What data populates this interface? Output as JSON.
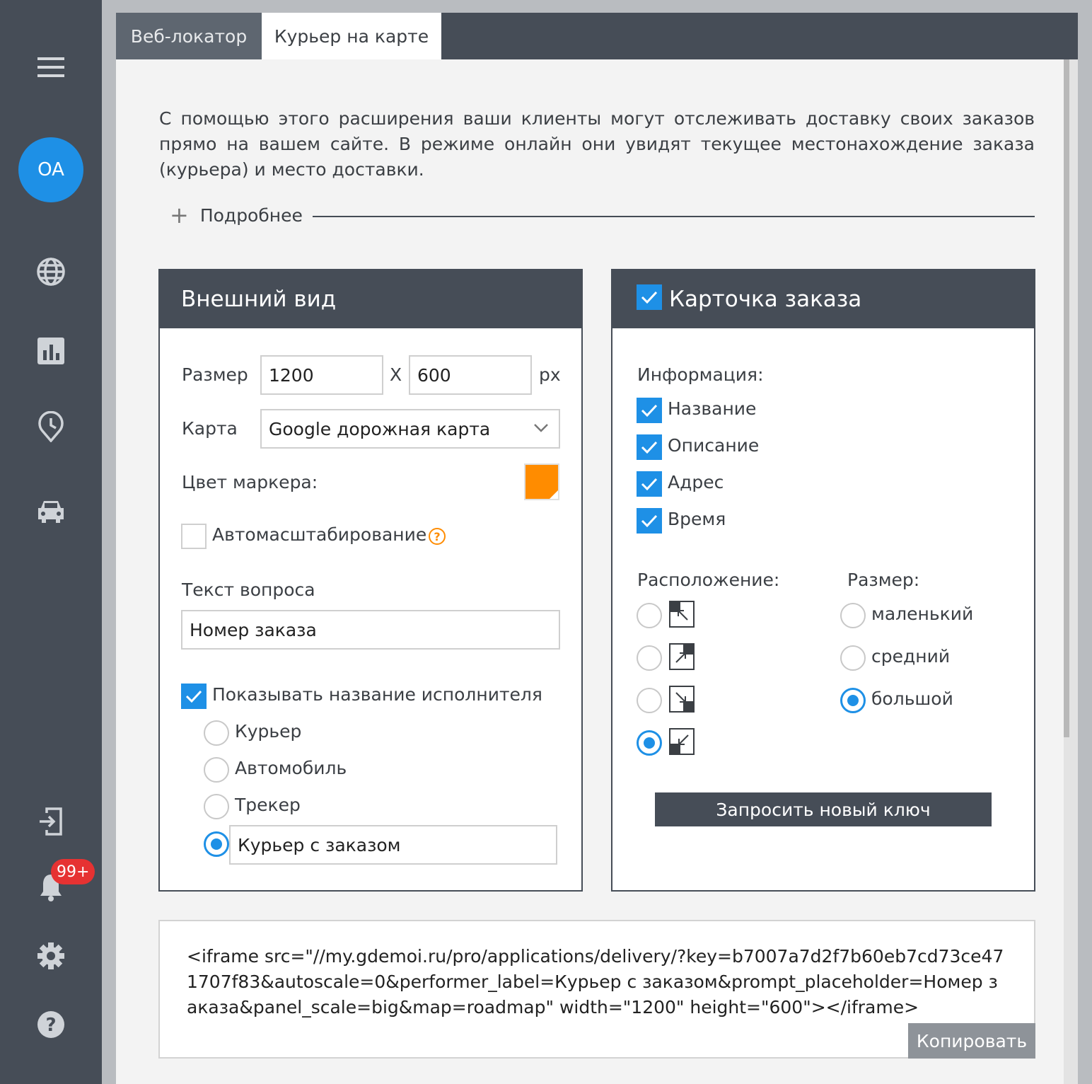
{
  "sidebar": {
    "avatar": "OA",
    "notifications_badge": "99+",
    "icons": [
      "menu-icon",
      "globe-icon",
      "chart-icon",
      "history-icon",
      "car-icon",
      "logout-icon",
      "bell-icon",
      "gear-icon",
      "help-icon"
    ]
  },
  "tabs": [
    {
      "label": "Веб-локатор",
      "active": false
    },
    {
      "label": "Курьер на карте",
      "active": true
    }
  ],
  "description": "С помощью этого расширения ваши клиенты могут отслеживать доставку своих заказов прямо на вашем сайте. В режиме онлайн они увидят текущее местонахождение заказа (курьера) и место доставки.",
  "more_label": "Подробнее",
  "appearance": {
    "title": "Внешний вид",
    "size_label": "Размер",
    "width": "1200",
    "x_label": "X",
    "height": "600",
    "unit": "px",
    "map_label": "Карта",
    "map_value": "Google дорожная карта",
    "marker_color_label": "Цвет маркера:",
    "marker_color": "#ff8c00",
    "autoscale_label": "Автомасштабирование",
    "autoscale_checked": false,
    "question_label": "Текст вопроса",
    "question_value": "Номер заказа",
    "show_performer_label": "Показывать название исполнителя",
    "show_performer_checked": true,
    "performer_options": [
      "Курьер",
      "Автомобиль",
      "Трекер",
      "Курьер с заказом"
    ],
    "performer_selected": "Курьер с заказом"
  },
  "order_card": {
    "title": "Карточка заказа",
    "enabled": true,
    "info_label": "Информация:",
    "info_items": [
      {
        "label": "Название",
        "checked": true
      },
      {
        "label": "Описание",
        "checked": true
      },
      {
        "label": "Адрес",
        "checked": true
      },
      {
        "label": "Время",
        "checked": true
      }
    ],
    "position_label": "Расположение:",
    "positions": [
      "top-left",
      "top-right",
      "bottom-right",
      "bottom-left"
    ],
    "position_selected": "bottom-left",
    "size_label": "Размер:",
    "sizes": [
      "маленький",
      "средний",
      "большой"
    ],
    "size_selected": "большой",
    "request_key_button": "Запросить новый ключ"
  },
  "embed_code": "<iframe src=\"//my.gdemoi.ru/pro/applications/delivery/?key=b7007a7d2f7b60eb7cd73ce471707f83&autoscale=0&performer_label=Курьер с заказом&prompt_placeholder=Номер заказа&panel_scale=big&map=roadmap\" width=\"1200\" height=\"600\"></iframe>",
  "copy_button": "Копировать",
  "colors": {
    "accent": "#1e90e6",
    "dark": "#464d57",
    "badge": "#e63232"
  }
}
